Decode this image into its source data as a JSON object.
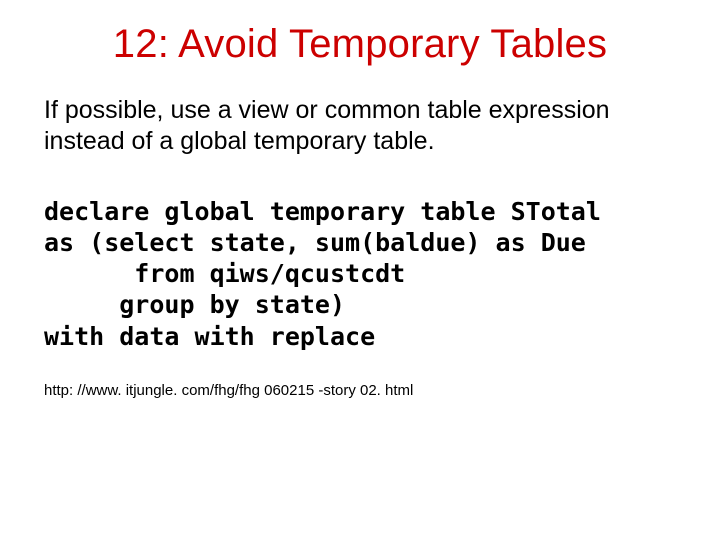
{
  "title": "12: Avoid Temporary Tables",
  "body": "If possible, use a view or common table expression instead of a global temporary table.",
  "code": "declare global temporary table STotal\nas (select state, sum(baldue) as Due\n      from qiws/qcustcdt\n     group by state)\nwith data with replace",
  "url": "http: //www. itjungle. com/fhg/fhg 060215 -story 02. html"
}
